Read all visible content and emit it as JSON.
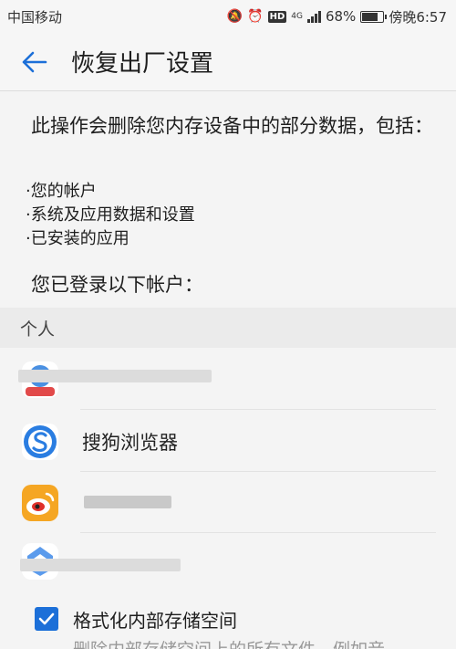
{
  "status_bar": {
    "carrier": "中国移动",
    "network": "4G",
    "hd": "HD",
    "battery": "68%",
    "time": "傍晚6:57"
  },
  "app_bar": {
    "title": "恢复出厂设置"
  },
  "description": "此操作会删除您内存设备中的部分数据，包括：",
  "bullets": [
    "·您的帐户",
    "·系统及应用数据和设置",
    "·已安装的应用"
  ],
  "accounts_label": "您已登录以下帐户：",
  "section_header": "个人",
  "accounts": [
    {
      "name": "",
      "icon": "huawei-account-icon"
    },
    {
      "name": "搜狗浏览器",
      "icon": "sogou-browser-icon"
    },
    {
      "name": "",
      "icon": "weibo-icon"
    },
    {
      "name": "",
      "icon": "baidu-icon"
    }
  ],
  "format_option": {
    "label": "格式化内部存储空间",
    "checked": true,
    "sub": "删除内部存储空间上的所有文件，例如音"
  },
  "colors": {
    "accent": "#1c6fd8",
    "weibo": "#f5a623",
    "sogou": "#2a7de1"
  }
}
